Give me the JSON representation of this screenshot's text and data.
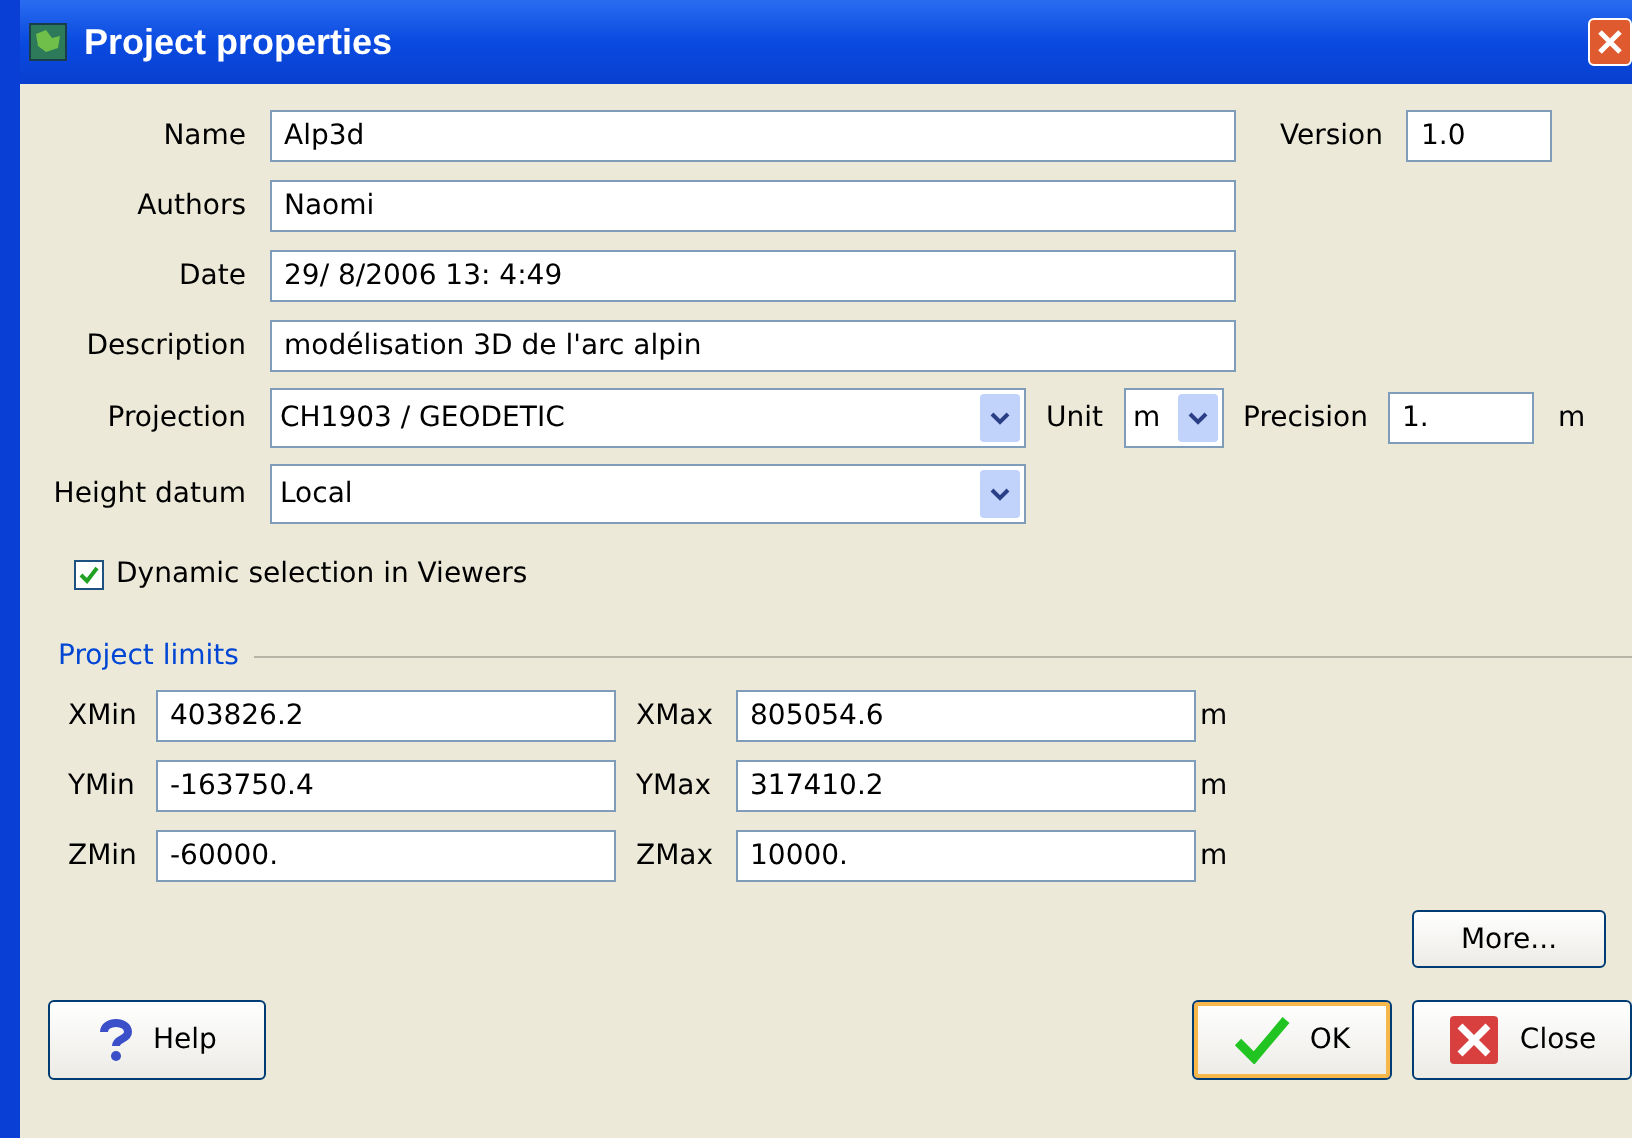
{
  "window": {
    "title": "Project properties"
  },
  "name": {
    "label": "Name",
    "value": "Alp3d"
  },
  "version": {
    "label": "Version",
    "value": "1.0"
  },
  "text_fields": [
    {
      "label": "Authors",
      "value": "Naomi"
    },
    {
      "label": "Date",
      "value": "29/ 8/2006 13: 4:49"
    },
    {
      "label": "Description",
      "value": "modélisation 3D de l'arc alpin"
    }
  ],
  "projection": {
    "label": "Projection",
    "value": "CH1903 / GEODETIC"
  },
  "unit": {
    "label": "Unit",
    "value": "m"
  },
  "precision": {
    "label": "Precision",
    "value": "1.",
    "unit": "m"
  },
  "height_datum": {
    "label": "Height datum",
    "value": "Local"
  },
  "dynamic_selection": {
    "label": "Dynamic selection in Viewers",
    "checked": true
  },
  "project_limits": {
    "title": "Project limits",
    "rows": [
      {
        "min_label": "XMin",
        "min_value": "403826.2",
        "max_label": "XMax",
        "max_value": "805054.6",
        "unit": "m"
      },
      {
        "min_label": "YMin",
        "min_value": "-163750.4",
        "max_label": "YMax",
        "max_value": "317410.2",
        "unit": "m"
      },
      {
        "min_label": "ZMin",
        "min_value": "-60000.",
        "max_label": "ZMax",
        "max_value": "10000.",
        "unit": "m"
      }
    ]
  },
  "more_button": "More...",
  "buttons": [
    {
      "kind": "help",
      "label": "Help"
    },
    {
      "kind": "ok",
      "label": "OK",
      "selected": true
    },
    {
      "kind": "close",
      "label": "Close",
      "selected": false
    }
  ]
}
